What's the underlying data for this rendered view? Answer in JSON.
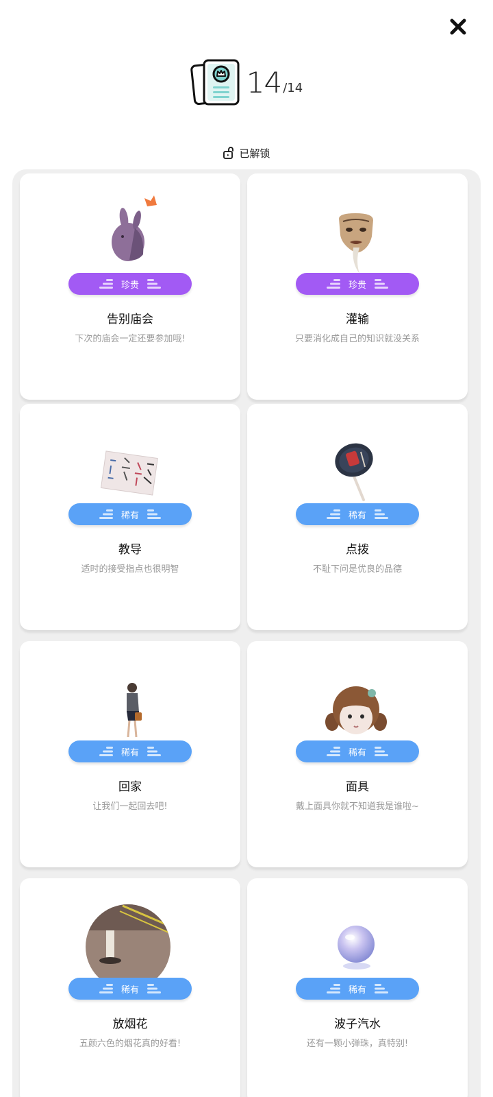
{
  "header": {
    "collected": "14",
    "total": "/14"
  },
  "filter": {
    "label": "已解锁"
  },
  "cards": [
    {
      "rarity": "珍贵",
      "title": "告别庙会",
      "desc": "下次的庙会一定还要参加哦!"
    },
    {
      "rarity": "珍贵",
      "title": "灌输",
      "desc": "只要消化成自己的知识就没关系"
    },
    {
      "rarity": "稀有",
      "title": "教导",
      "desc": "适时的接受指点也很明智"
    },
    {
      "rarity": "稀有",
      "title": "点拨",
      "desc": "不耻下问是优良的品德"
    },
    {
      "rarity": "稀有",
      "title": "回家",
      "desc": "让我们一起回去吧!"
    },
    {
      "rarity": "稀有",
      "title": "面具",
      "desc": "戴上面具你就不知道我是谁啦~"
    },
    {
      "rarity": "稀有",
      "title": "放烟花",
      "desc": "五颜六色的烟花真的好看!"
    },
    {
      "rarity": "稀有",
      "title": "波子汽水",
      "desc": "还有一颗小弹珠，真特别!"
    }
  ],
  "colors": {
    "precious": "#a25af4",
    "rare": "#5aa2f7",
    "panel": "#efefef",
    "teal": "#7fd3cf"
  },
  "icons": {
    "close": "close-icon",
    "collection": "card-collection-icon",
    "lock": "unlock-icon"
  }
}
